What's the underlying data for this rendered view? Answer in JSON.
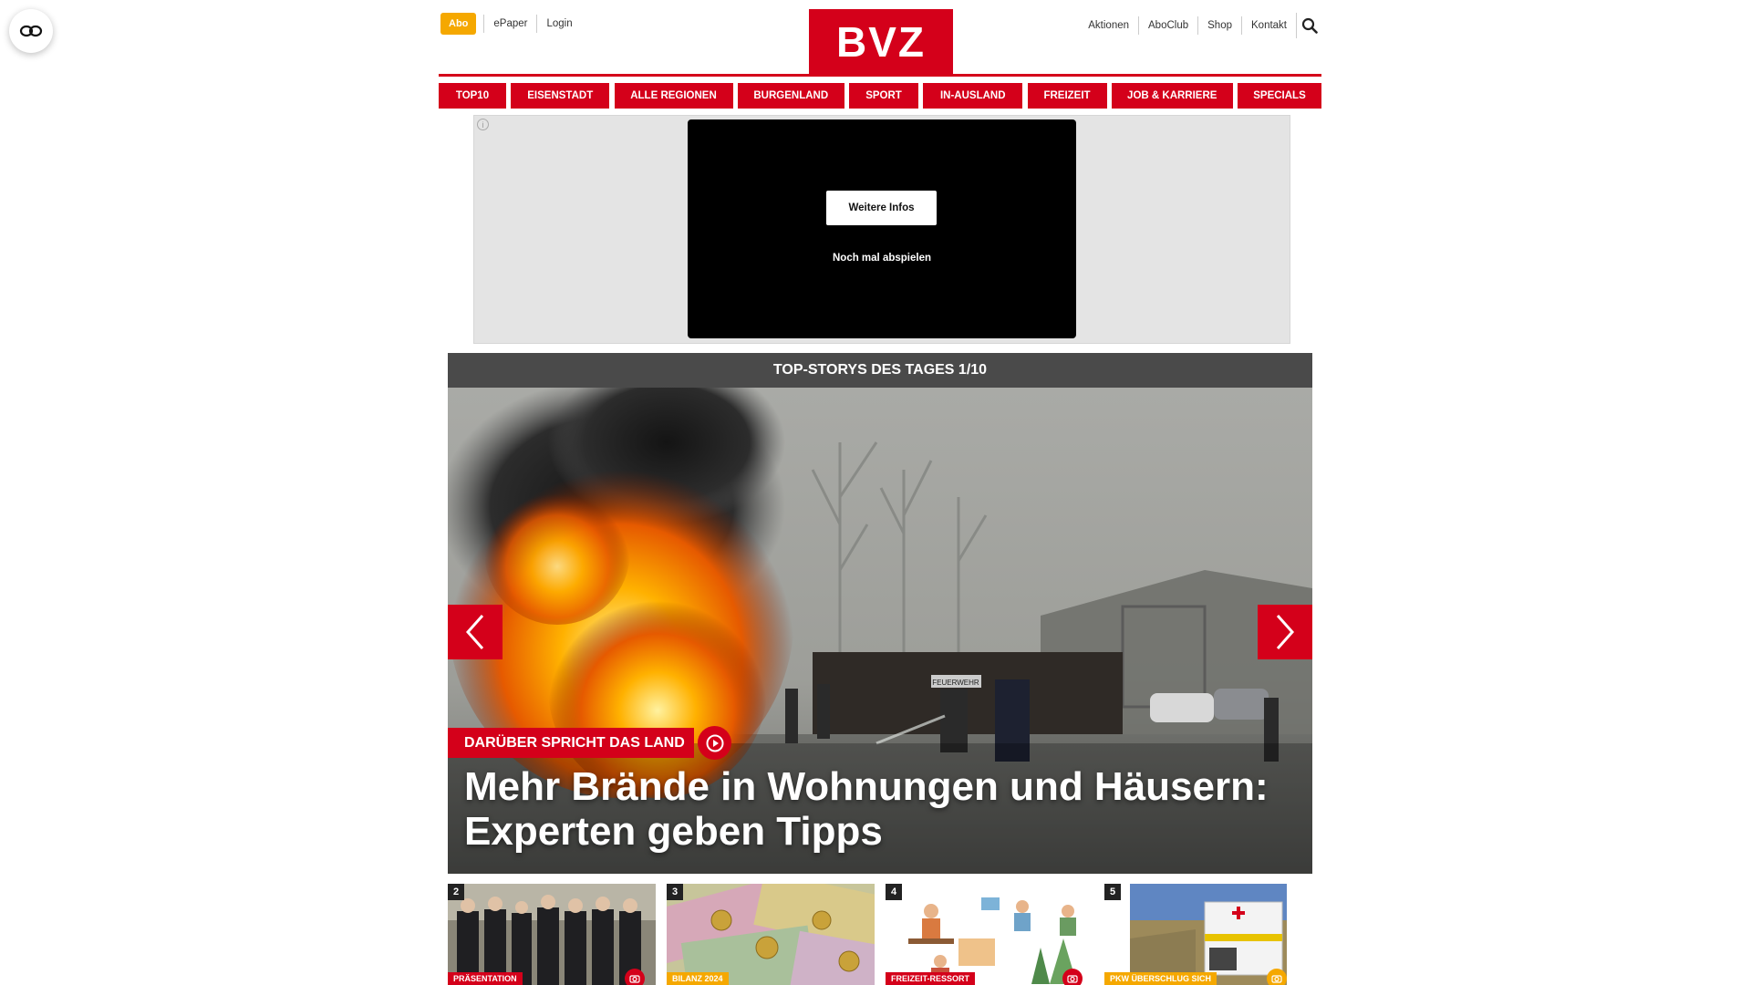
{
  "header": {
    "abo_label": "Abo",
    "epaper_label": "ePaper",
    "login_label": "Login",
    "logo_text": "BVZ",
    "right_links": [
      "Aktionen",
      "AboClub",
      "Shop",
      "Kontakt"
    ]
  },
  "nav": {
    "items": [
      "TOP10",
      "EISENSTADT",
      "ALLE REGIONEN",
      "BURGENLAND",
      "SPORT",
      "IN-AUSLAND",
      "FREIZEIT",
      "JOB & KARRIERE",
      "SPECIALS"
    ]
  },
  "ad": {
    "info_symbol": "i",
    "more_label": "Weitere Infos",
    "replay_label": "Noch mal abspielen"
  },
  "top_stories": {
    "heading": "TOP-STORYS DES TAGES 1/10",
    "hero": {
      "kicker": "DARÜBER SPRICHT DAS LAND",
      "headline": "Mehr Brände in Wohnungen und Häusern: Experten geben Tipps",
      "sign_text": "FEUERWEHR"
    },
    "thumbnails": [
      {
        "number": "2",
        "tag": "PRÄSENTATION",
        "tag_color": "#d4001a",
        "icon": "camera-icon"
      },
      {
        "number": "3",
        "tag": "BILANZ 2024",
        "tag_color": "#f5a800",
        "icon": ""
      },
      {
        "number": "4",
        "tag": "FREIZEIT-RESSORT",
        "tag_color": "#d4001a",
        "icon": "camera-icon"
      },
      {
        "number": "5",
        "tag": "PKW ÜBERSCHLUG SICH",
        "tag_color": "#f5a800",
        "icon": "camera-icon"
      }
    ]
  },
  "colors": {
    "brand_red": "#d4001a",
    "accent_yellow": "#f5a800",
    "header_gray": "#4a4a4a"
  }
}
